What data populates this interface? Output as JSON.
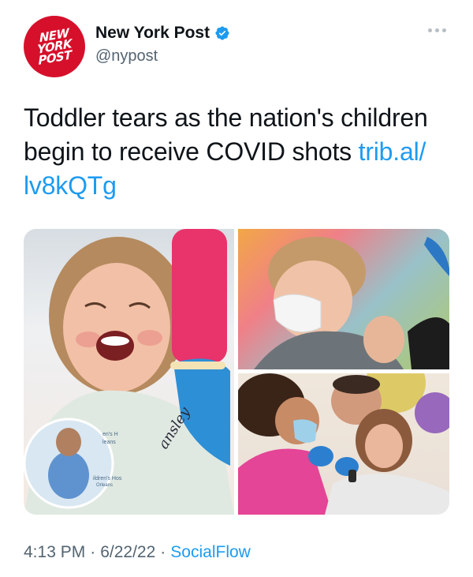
{
  "account": {
    "display_name": "New York Post",
    "handle": "@nypost",
    "avatar_logo": [
      "NEW",
      "YORK",
      "POST"
    ],
    "verified": true
  },
  "tweet": {
    "text": "Toddler tears as the nation's children begin to receive COVID shots ",
    "link_text": "trib.al/ lv8kQTg"
  },
  "media": {
    "image_text": [
      "ansley",
      "en's H",
      "leans",
      "ildren's Hos",
      "Orleans"
    ]
  },
  "meta": {
    "time": "4:13 PM",
    "date": "6/22/22",
    "source": "SocialFlow",
    "separator": "·"
  },
  "colors": {
    "link": "#1d9bf0",
    "secondary_text": "#536471",
    "brand_red": "#d6102b"
  },
  "icons": [
    "verified-badge-icon",
    "more-options-icon"
  ]
}
